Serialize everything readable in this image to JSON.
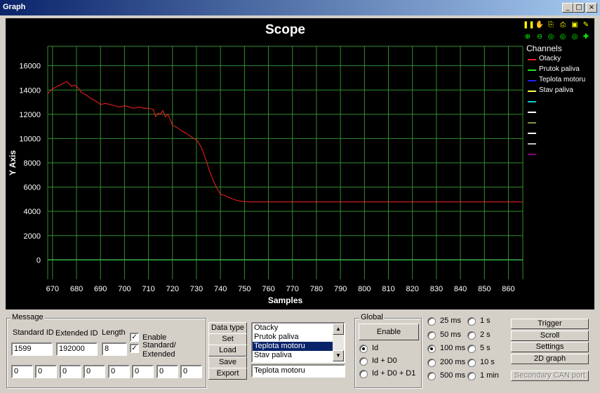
{
  "window": {
    "title": "Graph",
    "min_glyph": "_",
    "max_glyph": "□",
    "close_glyph": "×"
  },
  "chart_data": {
    "type": "line",
    "title": "Scope",
    "xlabel": "Samples",
    "ylabel": "Y Axis",
    "xlim": [
      668,
      866
    ],
    "ylim": [
      -1600,
      17600
    ],
    "x_ticks": [
      670,
      680,
      690,
      700,
      710,
      720,
      730,
      740,
      750,
      760,
      770,
      780,
      790,
      800,
      810,
      820,
      830,
      840,
      850,
      860
    ],
    "y_ticks": [
      0,
      2000,
      4000,
      6000,
      8000,
      10000,
      12000,
      14000,
      16000
    ],
    "grid": true,
    "legend_title": "Channels",
    "legend_position": "right",
    "series": [
      {
        "name": "Otacky",
        "color": "#ff2020",
        "x": [
          668,
          670,
          672,
          674,
          676,
          677,
          678,
          679,
          680,
          681,
          682,
          684,
          686,
          688,
          690,
          692,
          694,
          696,
          698,
          700,
          702,
          704,
          706,
          708,
          710,
          712,
          713,
          714,
          715,
          716,
          717,
          718,
          719,
          720,
          722,
          724,
          726,
          728,
          730,
          732,
          734,
          736,
          738,
          740,
          742,
          744,
          746,
          748,
          750,
          752,
          754,
          866
        ],
        "y": [
          13700,
          14100,
          14300,
          14500,
          14700,
          14500,
          14300,
          14400,
          14300,
          14100,
          13800,
          13600,
          13300,
          13100,
          12800,
          12900,
          12800,
          12700,
          12600,
          12700,
          12600,
          12500,
          12600,
          12500,
          12500,
          12400,
          11800,
          12100,
          12000,
          12300,
          11800,
          12000,
          11600,
          11100,
          10900,
          10600,
          10400,
          10100,
          9900,
          9300,
          8200,
          7000,
          6100,
          5400,
          5300,
          5100,
          4950,
          4850,
          4800,
          4780,
          4780,
          4780
        ]
      },
      {
        "name": "Prutok paliva",
        "color": "#20e020",
        "x": [
          668,
          866
        ],
        "y": [
          0,
          0
        ]
      },
      {
        "name": "Teplota motoru",
        "color": "#2020ff",
        "x": [
          668,
          866
        ],
        "y": [
          0,
          0
        ]
      },
      {
        "name": "Stav paliva",
        "color": "#ffff40",
        "x": [
          668,
          866
        ],
        "y": [
          0,
          0
        ]
      },
      {
        "name": "",
        "color": "#800080",
        "x": [
          668,
          866
        ],
        "y": [
          0,
          0
        ]
      }
    ],
    "extra_legend_colors": [
      "#00d0d0",
      "#ffffff",
      "#909040",
      "#ffffff",
      "#c0c0c0",
      "#800080"
    ]
  },
  "toolbar_icons": [
    {
      "name": "pause-icon",
      "glyph": "❚❚"
    },
    {
      "name": "hand-icon",
      "glyph": "✋"
    },
    {
      "name": "copy-icon",
      "glyph": "⎘"
    },
    {
      "name": "print-icon",
      "glyph": "⎙"
    },
    {
      "name": "save-icon",
      "glyph": "▣"
    },
    {
      "name": "settings-icon",
      "glyph": "✎"
    },
    {
      "name": "zoom-in-icon",
      "glyph": "⊕"
    },
    {
      "name": "zoom-out-icon",
      "glyph": "⊖"
    },
    {
      "name": "zoom-x-icon",
      "glyph": "◎"
    },
    {
      "name": "zoom-y-icon",
      "glyph": "◎"
    },
    {
      "name": "zoom-reset-icon",
      "glyph": "◎"
    },
    {
      "name": "add-icon",
      "glyph": "✚"
    }
  ],
  "message": {
    "group_label": "Message",
    "standard_id_label": "Standard ID",
    "extended_id_label": "Extended ID",
    "length_label": "Length",
    "standard_id": "1599",
    "extended_id": "192000",
    "length": "8",
    "enable_label": "Enable",
    "std_ext_label_1": "Standard/",
    "std_ext_label_2": "Extended",
    "check_glyph": "✓",
    "bytes": [
      "0",
      "0",
      "0",
      "0",
      "0",
      "0",
      "0",
      "0"
    ]
  },
  "buttons": {
    "data_type": "Data type",
    "set": "Set",
    "load": "Load",
    "save": "Save",
    "export": "Export"
  },
  "channel_list": {
    "items": [
      "Otacky",
      "Prutok paliva",
      "Teplota motoru",
      "Stav paliva"
    ],
    "selected_index": 2,
    "selected_value": "Teplota motoru"
  },
  "global": {
    "group_label": "Global",
    "enable_label": "Enable",
    "options": [
      "Id",
      "Id + D0",
      "Id + D0 + D1"
    ],
    "selected": 0
  },
  "intervals": {
    "col1": [
      "25 ms",
      "50 ms",
      "100 ms",
      "200 ms",
      "500 ms"
    ],
    "col2": [
      "1 s",
      "2 s",
      "5 s",
      "10 s",
      "1 min"
    ],
    "selected": "100 ms"
  },
  "right_buttons": {
    "trigger": "Trigger",
    "scroll": "Scroll",
    "settings": "Settings",
    "graph2d": "2D graph",
    "secondary_can": "Secondary CAN port"
  }
}
